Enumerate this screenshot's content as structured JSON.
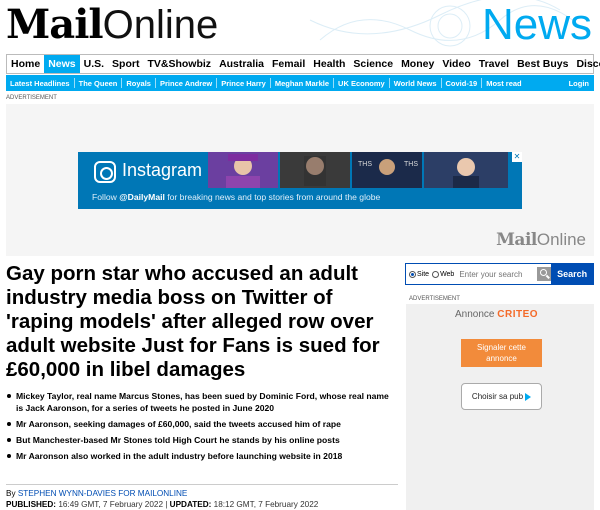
{
  "masthead": {
    "logo_mail": "Mail",
    "logo_online": "Online",
    "section": "News"
  },
  "nav_primary": [
    {
      "label": "Home",
      "active": false
    },
    {
      "label": "News",
      "active": true
    },
    {
      "label": "U.S.",
      "active": false
    },
    {
      "label": "Sport",
      "active": false
    },
    {
      "label": "TV&Showbiz",
      "active": false
    },
    {
      "label": "Australia",
      "active": false
    },
    {
      "label": "Femail",
      "active": false
    },
    {
      "label": "Health",
      "active": false
    },
    {
      "label": "Science",
      "active": false
    },
    {
      "label": "Money",
      "active": false
    },
    {
      "label": "Video",
      "active": false
    },
    {
      "label": "Travel",
      "active": false
    },
    {
      "label": "Best Buys",
      "active": false
    },
    {
      "label": "Discounts",
      "active": false
    }
  ],
  "nav_secondary": [
    "Latest Headlines",
    "The Queen",
    "Royals",
    "Prince Andrew",
    "Prince Harry",
    "Meghan Markle",
    "UK Economy",
    "World News",
    "Covid-19",
    "Most read"
  ],
  "nav_login": "Login",
  "advertisement_label": "ADVERTISEMENT",
  "ad_banner": {
    "title": "Instagram",
    "sub_prefix": "Follow ",
    "sub_handle": "@DailyMail",
    "sub_suffix": " for breaking news and top stories from around the globe",
    "close": "✕",
    "brand_mail": "Mail",
    "brand_online": "Online"
  },
  "article": {
    "headline": "Gay porn star who accused an adult industry media boss on Twitter of 'raping models' after alleged row over adult website Just for Fans is sued for £60,000 in libel damages",
    "bullets": [
      "Mickey Taylor, real name Marcus Stones, has been sued by Dominic Ford, whose real name is Jack Aaronson, for a series of tweets he posted in June 2020",
      "Mr Aaronson, seeking damages of £60,000, said the tweets accused him of rape",
      "But Manchester-based Mr Stones told High Court he stands by his online posts",
      "Mr Aaronson also worked in the adult industry before launching website in 2018"
    ],
    "by_prefix": "By ",
    "author": "STEPHEN WYNN-DAVIES FOR MAILONLINE",
    "published_label": "PUBLISHED:",
    "published_value": " 16:49 GMT, 7 February 2022 | ",
    "updated_label": "UPDATED:",
    "updated_value": " 18:12 GMT, 7 February 2022"
  },
  "search": {
    "option_site": "Site",
    "option_web": "Web",
    "selected": "Site",
    "placeholder": "Enter your search",
    "button": "Search"
  },
  "side_ad": {
    "label": "ADVERTISEMENT",
    "annonce": "Annonce",
    "criteo": "CRITEO",
    "signaler": "Signaler cette annonce",
    "choisir": "Choisir sa pub"
  }
}
